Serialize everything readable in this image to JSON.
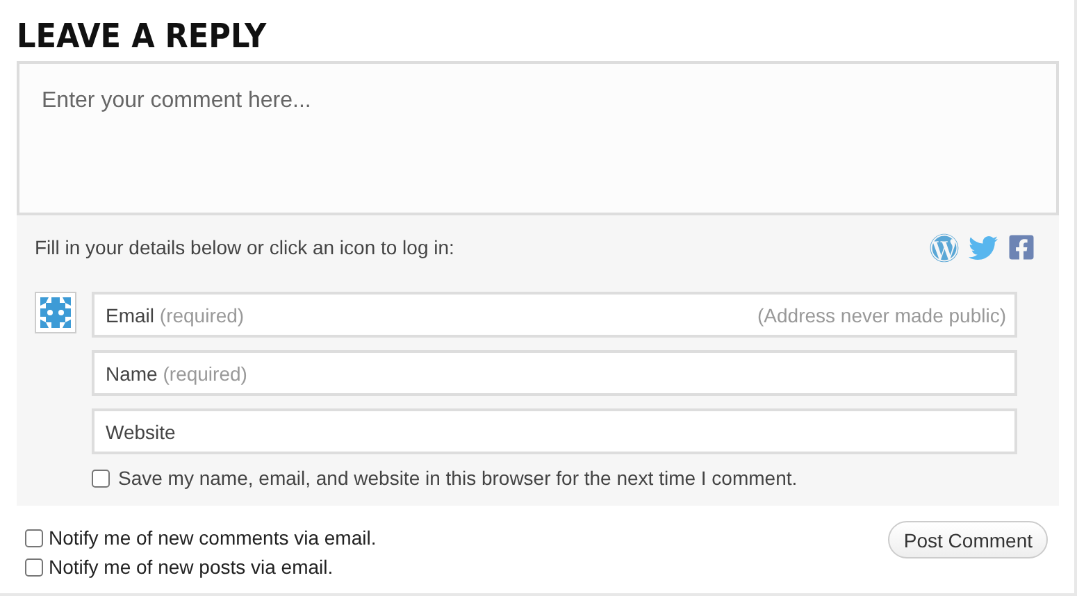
{
  "heading": "LEAVE A REPLY",
  "comment": {
    "placeholder": "Enter your comment here..."
  },
  "login_prompt": "Fill in your details below or click an icon to log in:",
  "login_icons": [
    {
      "kind": "wordpress"
    },
    {
      "kind": "twitter"
    },
    {
      "kind": "facebook"
    }
  ],
  "fields": [
    {
      "label": "Email",
      "note": "(required)",
      "hint": "(Address never made public)"
    },
    {
      "label": "Name",
      "note": "(required)"
    },
    {
      "label": "Website"
    }
  ],
  "save_details": {
    "label": "Save my name, email, and website in this browser for the next time I comment.",
    "checked": false
  },
  "notify": [
    {
      "label": "Notify me of new comments via email.",
      "checked": false
    },
    {
      "label": "Notify me of new posts via email.",
      "checked": false
    }
  ],
  "submit": "Post Comment"
}
